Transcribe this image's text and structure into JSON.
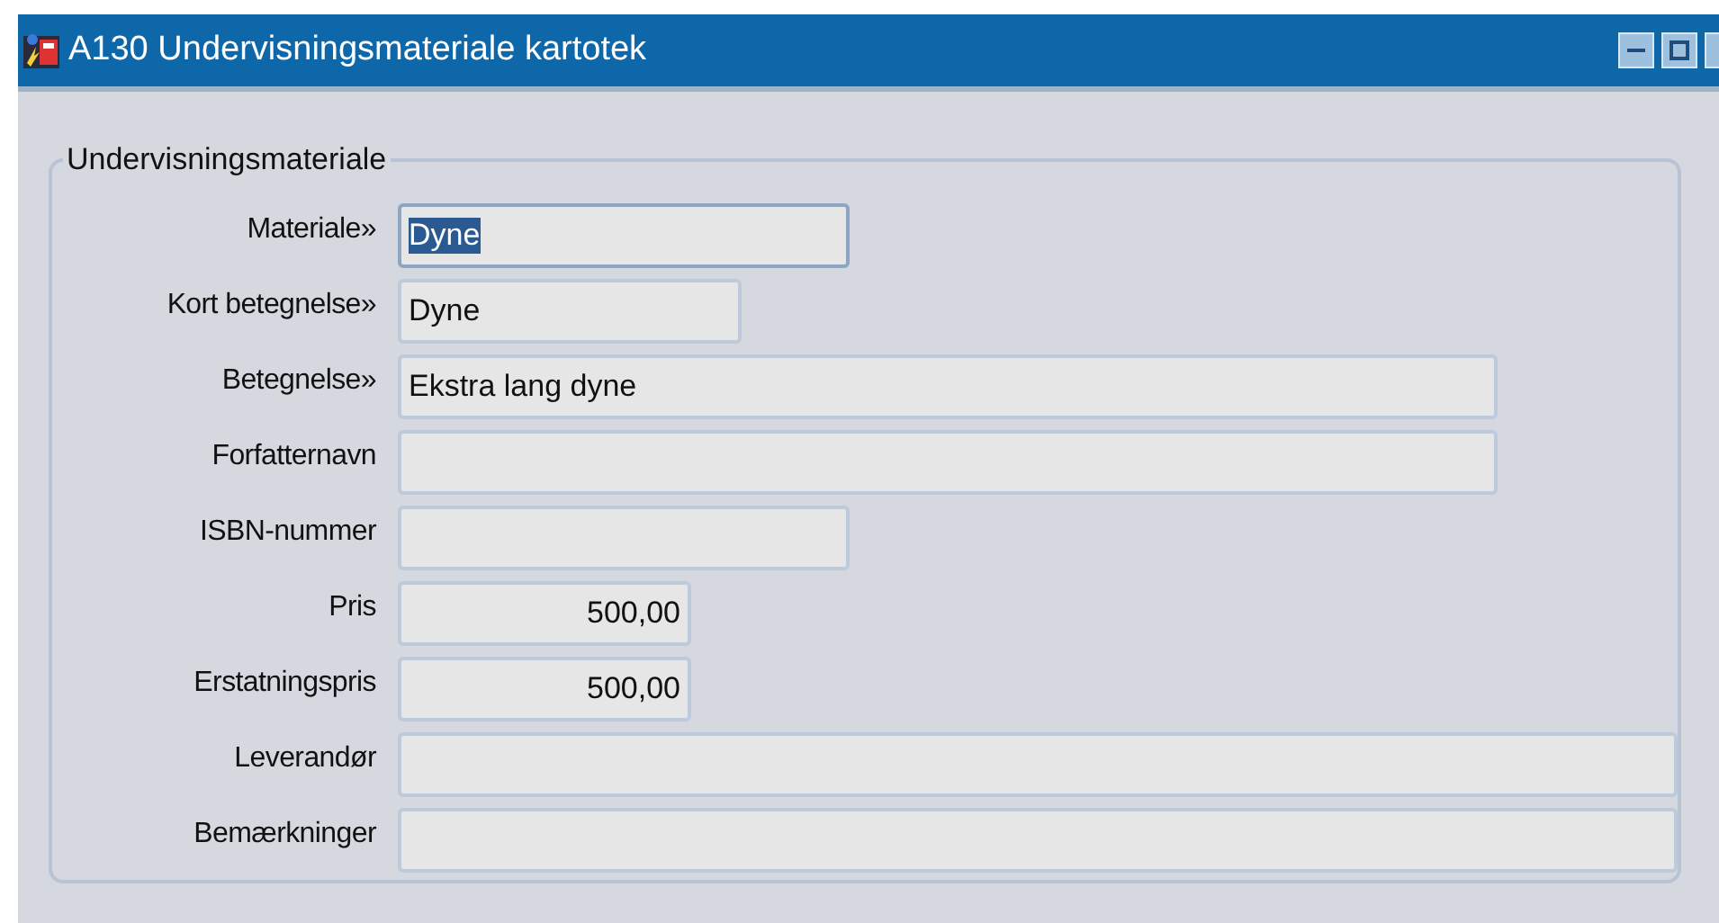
{
  "window": {
    "title": "A130 Undervisningsmateriale kartotek"
  },
  "group": {
    "legend": "Undervisningsmateriale"
  },
  "fields": [
    {
      "label": "Materiale»",
      "value": "Dyne",
      "kind": "text",
      "selected": true
    },
    {
      "label": "Kort betegnelse»",
      "value": "Dyne",
      "kind": "text",
      "selected": false
    },
    {
      "label": "Betegnelse»",
      "value": "Ekstra lang dyne",
      "kind": "text",
      "selected": false
    },
    {
      "label": "Forfatternavn",
      "kind": "text",
      "selected": false
    },
    {
      "label": "ISBN-nummer",
      "kind": "text",
      "selected": false
    },
    {
      "label": "Pris",
      "value": "500,00",
      "kind": "number",
      "selected": false
    },
    {
      "label": "Erstatningspris",
      "value": "500,00",
      "kind": "number",
      "selected": false
    },
    {
      "label": "Leverandør",
      "kind": "text",
      "selected": false
    },
    {
      "label": "Bemærkninger",
      "kind": "text",
      "selected": false
    }
  ]
}
